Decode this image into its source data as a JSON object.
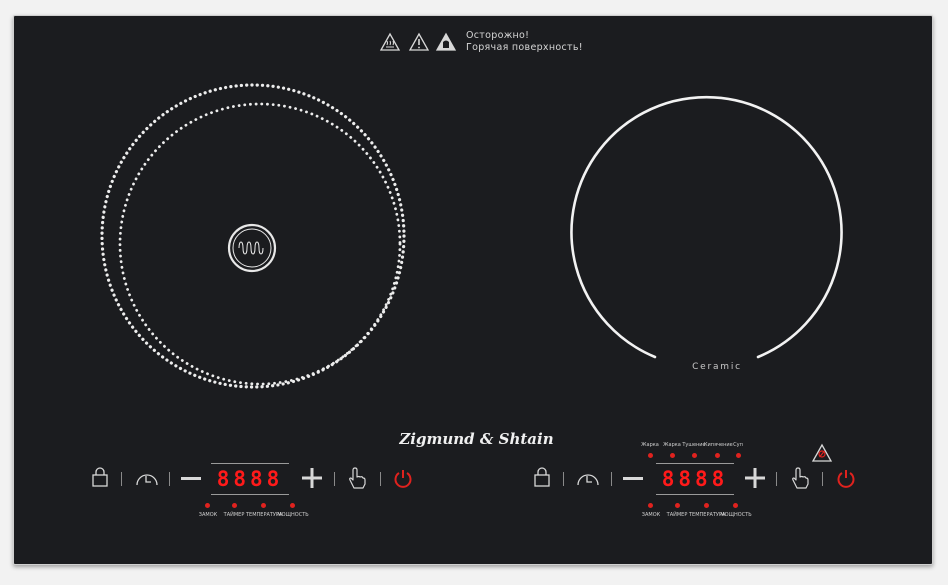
{
  "warning": {
    "line1": "Осторожно!",
    "line2": "Горячая поверхность!",
    "icons": [
      "hot-surface-icon",
      "warning-icon",
      "burn-hazard-icon"
    ]
  },
  "brand": "Zigmund & Shtain",
  "right_zone_label": "Ceramic",
  "zones": [
    {
      "id": "left",
      "type": "induction",
      "icon": "induction-coil-icon"
    },
    {
      "id": "right",
      "type": "ceramic"
    }
  ],
  "left_panel": {
    "display": "8888",
    "bottom_labels": [
      "ЗАМОК",
      "ТАЙМЕР",
      "ТЕМПЕРАТУРА",
      "МОЩНОСТЬ"
    ],
    "controls": [
      "lock-icon",
      "timer-icon",
      "minus-icon",
      "plus-icon",
      "touch-icon",
      "power-icon"
    ]
  },
  "right_panel": {
    "display": "8888",
    "mode_labels": [
      "Жарка",
      "Жарка",
      "Тушение",
      "Кипячение",
      "Суп"
    ],
    "bottom_labels": [
      "ЗАМОК",
      "ТАЙМЕР",
      "ТЕМПЕРАТУРА",
      "МОЩНОСТЬ"
    ],
    "controls": [
      "lock-icon",
      "timer-icon",
      "minus-icon",
      "plus-icon",
      "touch-icon",
      "power-icon"
    ]
  },
  "colors": {
    "glass": "#1b1c1f",
    "led_red": "#e0221e",
    "display_red": "#ff1a1a",
    "outline": "#d8d8d8"
  }
}
